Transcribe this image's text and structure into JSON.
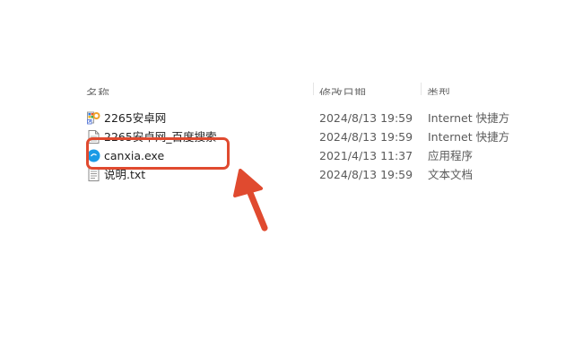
{
  "columns": {
    "name": "名称",
    "date": "修改日期",
    "type": "类型"
  },
  "files": [
    {
      "name": "2265安卓网",
      "date": "2024/8/13 19:59",
      "type": "Internet 快捷方",
      "icon": "internet-shortcut-icon"
    },
    {
      "name": "2265安卓网_百度搜索",
      "date": "2024/8/13 19:59",
      "type": "Internet 快捷方",
      "icon": "document-icon"
    },
    {
      "name": "canxia.exe",
      "date": "2021/4/13 11:37",
      "type": "应用程序",
      "icon": "app-icon"
    },
    {
      "name": "说明.txt",
      "date": "2024/8/13 19:59",
      "type": "文本文档",
      "icon": "text-file-icon"
    }
  ],
  "colors": {
    "highlight": "#e04a2f",
    "app_icon": "#1a9be6"
  }
}
